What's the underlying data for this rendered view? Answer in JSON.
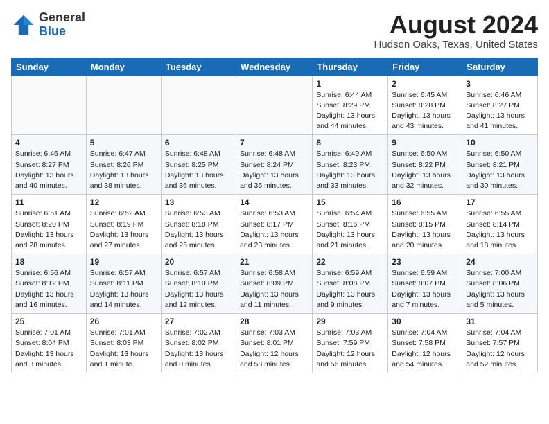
{
  "header": {
    "logo_general": "General",
    "logo_blue": "Blue",
    "month_title": "August 2024",
    "location": "Hudson Oaks, Texas, United States"
  },
  "weekdays": [
    "Sunday",
    "Monday",
    "Tuesday",
    "Wednesday",
    "Thursday",
    "Friday",
    "Saturday"
  ],
  "weeks": [
    [
      {
        "day": "",
        "info": ""
      },
      {
        "day": "",
        "info": ""
      },
      {
        "day": "",
        "info": ""
      },
      {
        "day": "",
        "info": ""
      },
      {
        "day": "1",
        "info": "Sunrise: 6:44 AM\nSunset: 8:29 PM\nDaylight: 13 hours\nand 44 minutes."
      },
      {
        "day": "2",
        "info": "Sunrise: 6:45 AM\nSunset: 8:28 PM\nDaylight: 13 hours\nand 43 minutes."
      },
      {
        "day": "3",
        "info": "Sunrise: 6:46 AM\nSunset: 8:27 PM\nDaylight: 13 hours\nand 41 minutes."
      }
    ],
    [
      {
        "day": "4",
        "info": "Sunrise: 6:46 AM\nSunset: 8:27 PM\nDaylight: 13 hours\nand 40 minutes."
      },
      {
        "day": "5",
        "info": "Sunrise: 6:47 AM\nSunset: 8:26 PM\nDaylight: 13 hours\nand 38 minutes."
      },
      {
        "day": "6",
        "info": "Sunrise: 6:48 AM\nSunset: 8:25 PM\nDaylight: 13 hours\nand 36 minutes."
      },
      {
        "day": "7",
        "info": "Sunrise: 6:48 AM\nSunset: 8:24 PM\nDaylight: 13 hours\nand 35 minutes."
      },
      {
        "day": "8",
        "info": "Sunrise: 6:49 AM\nSunset: 8:23 PM\nDaylight: 13 hours\nand 33 minutes."
      },
      {
        "day": "9",
        "info": "Sunrise: 6:50 AM\nSunset: 8:22 PM\nDaylight: 13 hours\nand 32 minutes."
      },
      {
        "day": "10",
        "info": "Sunrise: 6:50 AM\nSunset: 8:21 PM\nDaylight: 13 hours\nand 30 minutes."
      }
    ],
    [
      {
        "day": "11",
        "info": "Sunrise: 6:51 AM\nSunset: 8:20 PM\nDaylight: 13 hours\nand 28 minutes."
      },
      {
        "day": "12",
        "info": "Sunrise: 6:52 AM\nSunset: 8:19 PM\nDaylight: 13 hours\nand 27 minutes."
      },
      {
        "day": "13",
        "info": "Sunrise: 6:53 AM\nSunset: 8:18 PM\nDaylight: 13 hours\nand 25 minutes."
      },
      {
        "day": "14",
        "info": "Sunrise: 6:53 AM\nSunset: 8:17 PM\nDaylight: 13 hours\nand 23 minutes."
      },
      {
        "day": "15",
        "info": "Sunrise: 6:54 AM\nSunset: 8:16 PM\nDaylight: 13 hours\nand 21 minutes."
      },
      {
        "day": "16",
        "info": "Sunrise: 6:55 AM\nSunset: 8:15 PM\nDaylight: 13 hours\nand 20 minutes."
      },
      {
        "day": "17",
        "info": "Sunrise: 6:55 AM\nSunset: 8:14 PM\nDaylight: 13 hours\nand 18 minutes."
      }
    ],
    [
      {
        "day": "18",
        "info": "Sunrise: 6:56 AM\nSunset: 8:12 PM\nDaylight: 13 hours\nand 16 minutes."
      },
      {
        "day": "19",
        "info": "Sunrise: 6:57 AM\nSunset: 8:11 PM\nDaylight: 13 hours\nand 14 minutes."
      },
      {
        "day": "20",
        "info": "Sunrise: 6:57 AM\nSunset: 8:10 PM\nDaylight: 13 hours\nand 12 minutes."
      },
      {
        "day": "21",
        "info": "Sunrise: 6:58 AM\nSunset: 8:09 PM\nDaylight: 13 hours\nand 11 minutes."
      },
      {
        "day": "22",
        "info": "Sunrise: 6:59 AM\nSunset: 8:08 PM\nDaylight: 13 hours\nand 9 minutes."
      },
      {
        "day": "23",
        "info": "Sunrise: 6:59 AM\nSunset: 8:07 PM\nDaylight: 13 hours\nand 7 minutes."
      },
      {
        "day": "24",
        "info": "Sunrise: 7:00 AM\nSunset: 8:06 PM\nDaylight: 13 hours\nand 5 minutes."
      }
    ],
    [
      {
        "day": "25",
        "info": "Sunrise: 7:01 AM\nSunset: 8:04 PM\nDaylight: 13 hours\nand 3 minutes."
      },
      {
        "day": "26",
        "info": "Sunrise: 7:01 AM\nSunset: 8:03 PM\nDaylight: 13 hours\nand 1 minute."
      },
      {
        "day": "27",
        "info": "Sunrise: 7:02 AM\nSunset: 8:02 PM\nDaylight: 13 hours\nand 0 minutes."
      },
      {
        "day": "28",
        "info": "Sunrise: 7:03 AM\nSunset: 8:01 PM\nDaylight: 12 hours\nand 58 minutes."
      },
      {
        "day": "29",
        "info": "Sunrise: 7:03 AM\nSunset: 7:59 PM\nDaylight: 12 hours\nand 56 minutes."
      },
      {
        "day": "30",
        "info": "Sunrise: 7:04 AM\nSunset: 7:58 PM\nDaylight: 12 hours\nand 54 minutes."
      },
      {
        "day": "31",
        "info": "Sunrise: 7:04 AM\nSunset: 7:57 PM\nDaylight: 12 hours\nand 52 minutes."
      }
    ]
  ]
}
